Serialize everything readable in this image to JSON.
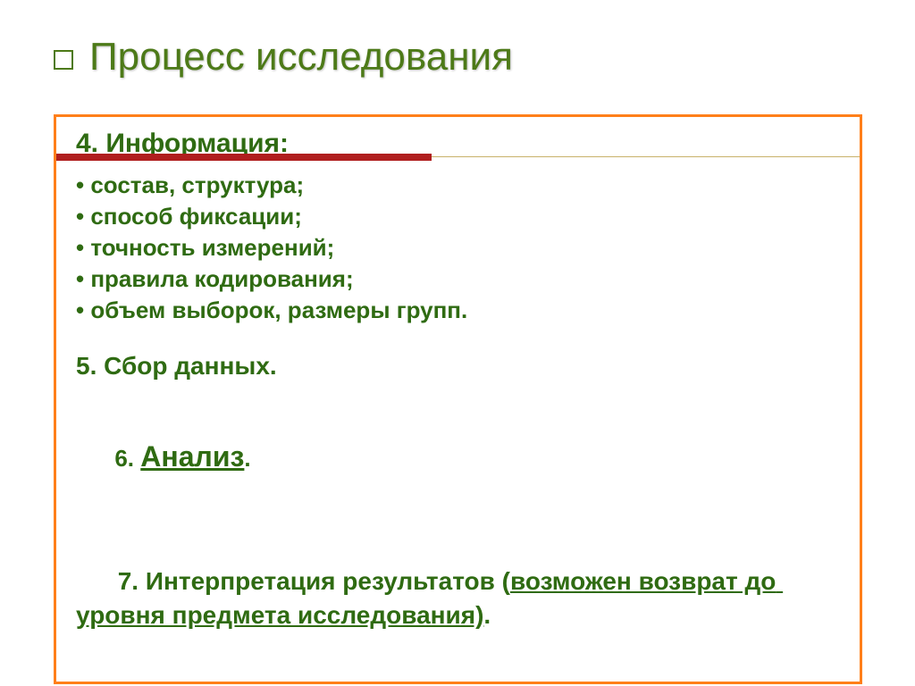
{
  "title": "Процесс исследования",
  "section4": {
    "heading": "4. Информация:",
    "bullets": [
      "состав, структура;",
      "способ фиксации;",
      "точность измерений;",
      "правила кодирования;",
      "объем выборок, размеры групп."
    ]
  },
  "section5": "5. Сбор данных.",
  "section6": {
    "num": "6. ",
    "word": "Анализ",
    "tail": "."
  },
  "section7": {
    "pre": "7. Интерпретация результатов (",
    "underlined": "возможен возврат до уровня предмета исследования)",
    "post": "."
  }
}
